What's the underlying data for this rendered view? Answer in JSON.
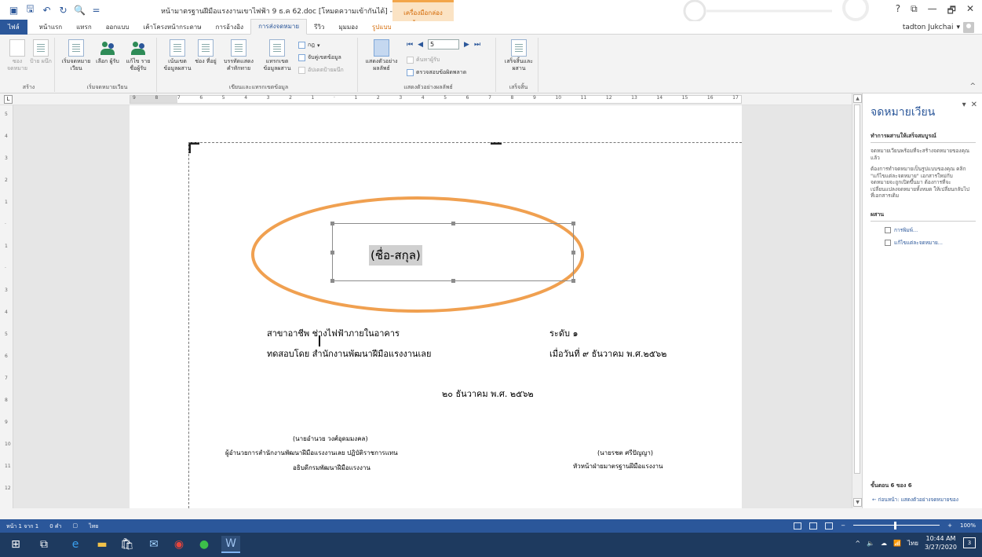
{
  "titlebar": {
    "doc_title": "หน้ามาตรฐานฝีมือแรงงานเขาไฟฟ้า 9 ธ.ค 62.doc [โหมดความเข้ากันได้] - Word",
    "context_tab": "เครื่องมือกล่องข้อความ",
    "controls": [
      "?",
      "⧉",
      "—",
      "🗗",
      "✕"
    ]
  },
  "tabs": [
    {
      "label": "ไฟล์"
    },
    {
      "label": "หน้าแรก"
    },
    {
      "label": "แทรก"
    },
    {
      "label": "ออกแบบ"
    },
    {
      "label": "เค้าโครงหน้ากระดาษ"
    },
    {
      "label": "การอ้างอิง"
    },
    {
      "label": "การส่งจดหมาย"
    },
    {
      "label": "รีวิว"
    },
    {
      "label": "มุมมอง"
    },
    {
      "label": "รูปแบบ"
    }
  ],
  "account": {
    "name": "tadton Jukchai"
  },
  "ribbon": {
    "create": {
      "label": "สร้าง",
      "envelopes": "ซอง จดหมาย",
      "labels": "ป้าย ผนึก"
    },
    "start": {
      "label": "เริ่มจดหมายเวียน",
      "start_merge": "เริ่มจดหมาย เวียน",
      "select_recipients": "เลือก ผู้รับ",
      "edit_list": "แก้ไข รายชื่อผู้รับ"
    },
    "fields": {
      "label": "เขียนและแทรกเขตข้อมูล",
      "highlight": "เน้นเขต ข้อมูลผสาน",
      "address_block": "ช่อง ที่อยู่",
      "greeting": "บรรทัดแสดง คำทักทาย",
      "insert_field": "แทรกเขต ข้อมูลผสาน",
      "rules": "กฎ",
      "match_fields": "จับคู่เขตข้อมูล",
      "update_labels": "อัปเดตป้ายผนึก"
    },
    "preview": {
      "label": "แสดงตัวอย่างผลลัพธ์",
      "preview_results": "แสดงตัวอย่าง ผลลัพธ์",
      "record": "5",
      "find_recipient": "ค้นหาผู้รับ",
      "check_errors": "ตรวจสอบข้อผิดพลาด"
    },
    "finish": {
      "label": "เสร็จสิ้น",
      "finish_merge": "เสร็จสิ้นและ ผสาน"
    }
  },
  "ruler": {
    "numbers": [
      "9",
      "8",
      "7",
      "6",
      "5",
      "4",
      "3",
      "2",
      "1",
      "",
      "1",
      "2",
      "3",
      "4",
      "5",
      "6",
      "7",
      "8",
      "9",
      "10",
      "11",
      "12",
      "13",
      "14",
      "15",
      "16",
      "17"
    ],
    "vertical": [
      "5",
      "4",
      "3",
      "2",
      "1",
      "",
      "1",
      "",
      "3",
      "4",
      "5",
      "6",
      "7",
      "8",
      "9",
      "10",
      "11",
      "12"
    ]
  },
  "document": {
    "merge_field": "(ชื่อ-สกุล)",
    "line1_left": "สาขาอาชีพ   ช่างไฟฟ้าภายในอาคาร",
    "line1_right": "ระดับ     ๑",
    "line2_left": "ทดสอบโดย   สำนักงานพัฒนาฝีมือแรงงานเลย",
    "line2_right": "เมื่อวันที่   ๙  ธันวาคม พ.ศ.๒๕๖๒",
    "date_line": "๒๐ ธันวาคม  พ.ศ.  ๒๕๖๒",
    "sig1_name": "(นายอำนวย วงศ์อุดมมงคล)",
    "sig1_title1": "ผู้อำนวยการสำนักงานพัฒนาฝีมือแรงงานเลย  ปฏิบัติราชการแทน",
    "sig1_title2": "อธิบดีกรมพัฒนาฝีมือแรงงาน",
    "sig2_name": "(นายรชต  ศรีปัญญา)",
    "sig2_title": "หัวหน้าฝ่ายมาตรฐานฝีมือแรงงาน"
  },
  "taskpane": {
    "title": "จดหมายเวียน",
    "section1": "ทำการผสานให้เสร็จสมบูรณ์",
    "para1": "จดหมายเวียนพร้อมที่จะสร้างจดหมายของคุณแล้ว",
    "para2": "ต้องการทำจดหมายเป็นรูปแบบของคุณ คลิก \"แก้ไขแต่ละจดหมาย\" เอกสารใหม่กับจดหมายจะถูกเปิดขึ้นมา ต้องการที่จะเปลี่ยนแปลงจดหมายทั้งหมด ให้เปลี่ยนกลับไปที่เอกสารเดิม",
    "section2": "ผสาน",
    "link1": "การพิมพ์...",
    "link2": "แก้ไขแต่ละจดหมาย...",
    "step": "ขั้นตอน 6 ของ 6",
    "prev": "ก่อนหน้า: แสดงตัวอย่างจดหมายของ"
  },
  "statusbar": {
    "page": "หน้า 1 จาก 1",
    "words": "0 คำ",
    "lang": "ไทย",
    "zoom": "100%"
  },
  "taskbar": {
    "lang": "ไทย",
    "time": "10:44 AM",
    "date": "3/27/2020",
    "notifications": "3"
  },
  "colors": {
    "accent": "#2b579a",
    "ellipse": "#f0a050",
    "context": "#d46b08"
  }
}
